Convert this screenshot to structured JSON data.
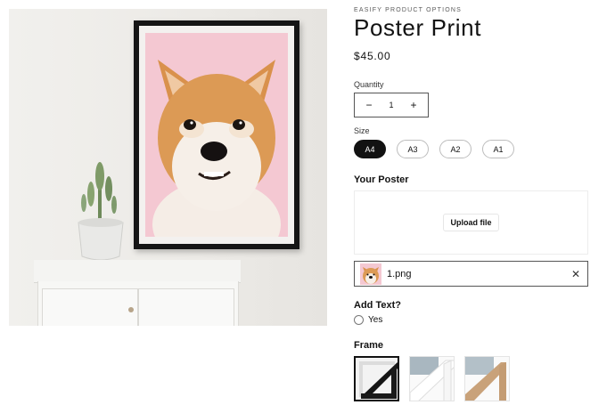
{
  "product": {
    "vendor": "EASIFY PRODUCT OPTIONS",
    "title": "Poster Print",
    "price": "$45.00"
  },
  "quantity": {
    "label": "Quantity",
    "value": "1",
    "decrement_icon": "minus-icon",
    "increment_icon": "plus-icon"
  },
  "size": {
    "label": "Size",
    "selected": "A4",
    "options": [
      "A4",
      "A3",
      "A2",
      "A1"
    ]
  },
  "your_poster": {
    "label": "Your Poster",
    "upload_button": "Upload file",
    "uploaded_file": "1.png",
    "remove_icon": "close-icon"
  },
  "add_text": {
    "label": "Add Text?",
    "option": "Yes"
  },
  "frame": {
    "label": "Frame",
    "options": [
      "black-frame",
      "white-frame",
      "oak-frame"
    ],
    "selected": "black-frame"
  },
  "colors": {
    "accent": "#121212",
    "poster_background": "#f4c8d2"
  }
}
